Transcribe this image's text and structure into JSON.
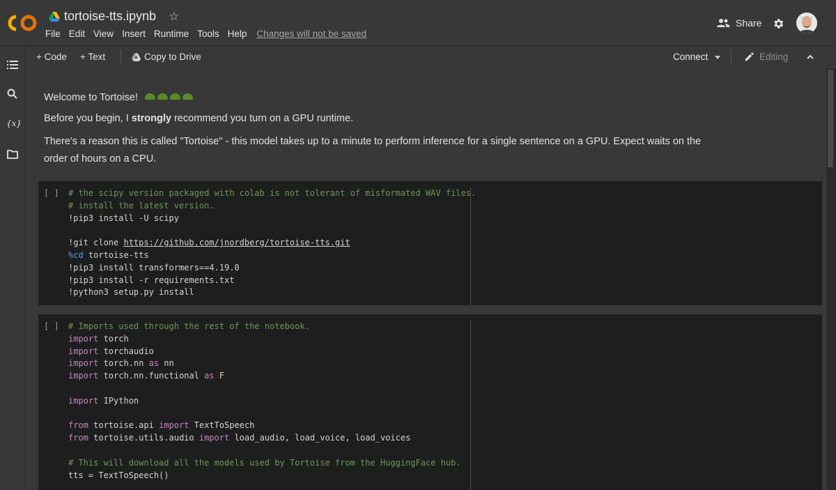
{
  "header": {
    "logo_text": "CO",
    "notebook_title": "tortoise-tts.ipynb",
    "menu": [
      "File",
      "Edit",
      "View",
      "Insert",
      "Runtime",
      "Tools",
      "Help"
    ],
    "unsaved_notice": "Changes will not be saved",
    "share_label": "Share"
  },
  "toolbar": {
    "add_code": "+ Code",
    "add_text": "+ Text",
    "copy_to_drive": "Copy to Drive",
    "connect": "Connect",
    "editing": "Editing"
  },
  "rail": {
    "icons": [
      "table-of-contents-icon",
      "search-icon",
      "variables-icon",
      "files-icon"
    ],
    "variables_glyph": "{x}"
  },
  "text_cell": {
    "line1": "Welcome to Tortoise!",
    "line2_pre": "Before you begin, I ",
    "line2_bold": "strongly",
    "line2_post": " recommend you turn on a GPU runtime.",
    "line3": "There's a reason this is called \"Tortoise\" - this model takes up to a minute to perform inference for a single sentence on a GPU. Expect waits on the order of hours on a CPU."
  },
  "cells": [
    {
      "run_label": "[ ]",
      "lines": [
        [
          {
            "t": "# the scipy version packaged with colab is not tolerant of misformated WAV files.",
            "c": "cmt"
          }
        ],
        [
          {
            "t": "# install the latest version.",
            "c": "cmt"
          }
        ],
        [
          {
            "t": "!pip3 install -U scipy",
            "c": ""
          }
        ],
        [
          {
            "t": "",
            "c": ""
          }
        ],
        [
          {
            "t": "!git clone ",
            "c": ""
          },
          {
            "t": "https://github.com/jnordberg/tortoise-tts.git",
            "c": "lnk"
          }
        ],
        [
          {
            "t": "%cd",
            "c": "mg"
          },
          {
            "t": " tortoise-tts",
            "c": ""
          }
        ],
        [
          {
            "t": "!pip3 install transformers==4.19.0",
            "c": ""
          }
        ],
        [
          {
            "t": "!pip3 install -r requirements.txt",
            "c": ""
          }
        ],
        [
          {
            "t": "!python3 setup.py install",
            "c": ""
          }
        ]
      ]
    },
    {
      "run_label": "[ ]",
      "lines": [
        [
          {
            "t": "# Imports used through the rest of the notebook.",
            "c": "cmt"
          }
        ],
        [
          {
            "t": "import",
            "c": "kw"
          },
          {
            "t": " torch",
            "c": ""
          }
        ],
        [
          {
            "t": "import",
            "c": "kw"
          },
          {
            "t": " torchaudio",
            "c": ""
          }
        ],
        [
          {
            "t": "import",
            "c": "kw"
          },
          {
            "t": " torch.nn ",
            "c": ""
          },
          {
            "t": "as",
            "c": "kw"
          },
          {
            "t": " nn",
            "c": ""
          }
        ],
        [
          {
            "t": "import",
            "c": "kw"
          },
          {
            "t": " torch.nn.functional ",
            "c": ""
          },
          {
            "t": "as",
            "c": "kw"
          },
          {
            "t": " F",
            "c": ""
          }
        ],
        [
          {
            "t": "",
            "c": ""
          }
        ],
        [
          {
            "t": "import",
            "c": "kw"
          },
          {
            "t": " IPython",
            "c": ""
          }
        ],
        [
          {
            "t": "",
            "c": ""
          }
        ],
        [
          {
            "t": "from",
            "c": "kw"
          },
          {
            "t": " tortoise.api ",
            "c": ""
          },
          {
            "t": "import",
            "c": "kw"
          },
          {
            "t": " TextToSpeech",
            "c": ""
          }
        ],
        [
          {
            "t": "from",
            "c": "kw"
          },
          {
            "t": " tortoise.utils.audio ",
            "c": ""
          },
          {
            "t": "import",
            "c": "kw"
          },
          {
            "t": " load_audio, load_voice, load_voices",
            "c": ""
          }
        ],
        [
          {
            "t": "",
            "c": ""
          }
        ],
        [
          {
            "t": "# This will download all the models used by Tortoise from the HuggingFace hub.",
            "c": "cmt"
          }
        ],
        [
          {
            "t": "tts = TextToSpeech()",
            "c": ""
          }
        ]
      ]
    }
  ]
}
